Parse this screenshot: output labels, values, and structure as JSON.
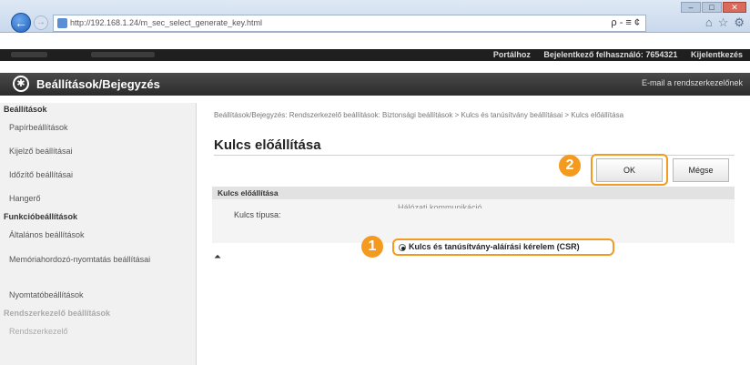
{
  "browser": {
    "url": "http://192.168.1.24/m_sec_select_generate_key.html",
    "search_label": "ρ - ≡ ¢",
    "window_controls": [
      "–",
      "□",
      "✕"
    ]
  },
  "topbar": {
    "links": [
      "Portálhoz",
      "Bejelentkező felhasználó: 7654321",
      "Kijelentkezés"
    ]
  },
  "header": {
    "title": "Beállítások/Bejegyzés",
    "mail_link": "E-mail a rendszerkezelőnek"
  },
  "sidebar": {
    "section1": "Beállítások",
    "items1": [
      "Papírbeállítások",
      "Kijelző beállításai",
      "Időzítő beállításai",
      "Hangerő"
    ],
    "section2": "Funkcióbeállítások",
    "items2": [
      "Általános beállítások",
      "Memóriahordozó-nyomtatás beállításai",
      "Nyomtatóbeállítások"
    ],
    "section3": "Rendszerkezelő beállítások",
    "items3": [
      "Rendszerkezelő"
    ]
  },
  "main": {
    "breadcrumb": "Beállítások/Bejegyzés: Rendszerkezelő beállítások: Biztonsági beállítások > Kulcs és tanúsítvány beállításai > Kulcs előállítása",
    "page_title": "Kulcs előállítása",
    "ok_label": "OK",
    "cancel_label": "Mégse",
    "section_title": "Kulcs előállítása",
    "key_type_label": "Kulcs típusa:",
    "option1": "Hálózati kommunikáció",
    "option2": "Kulcs és tanúsítvány-aláírási kérelem (CSR)",
    "badge1": "1",
    "badge2": "2",
    "to_top": "⏶"
  },
  "colors": {
    "highlight": "#f39a1f",
    "header": "#2b2b2b"
  }
}
